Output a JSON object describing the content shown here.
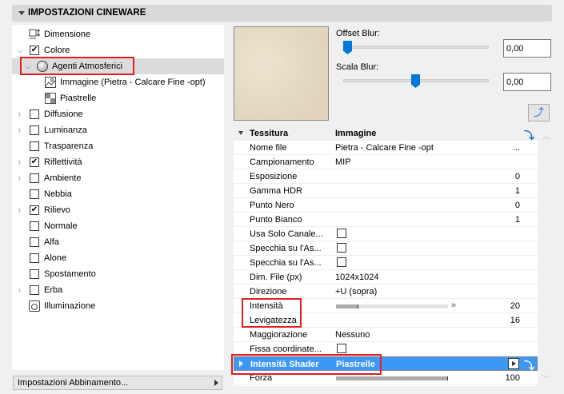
{
  "header": {
    "title": "IMPOSTAZIONI CINEWARE"
  },
  "tree": [
    {
      "label": "Dimensione",
      "icon": "dimension-icon",
      "level": 0,
      "arrow": "none"
    },
    {
      "label": "Colore",
      "check": true,
      "level": 0,
      "arrow": "open"
    },
    {
      "label": "Agenti Atmosferici",
      "icon": "sphere-icon",
      "level": 1,
      "arrow": "open",
      "selected": true
    },
    {
      "label": "Immagine (Pietra - Calcare Fine -opt)",
      "icon": "image-icon",
      "level": 2,
      "arrow": "none"
    },
    {
      "label": "Piastrelle",
      "icon": "tiles-icon",
      "level": 2,
      "arrow": "none"
    },
    {
      "label": "Diffusione",
      "check": false,
      "level": 0,
      "arrow": "closed"
    },
    {
      "label": "Luminanza",
      "check": false,
      "level": 0,
      "arrow": "closed"
    },
    {
      "label": "Trasparenza",
      "check": false,
      "level": 0,
      "arrow": "none"
    },
    {
      "label": "Riflettività",
      "check": true,
      "level": 0,
      "arrow": "closed"
    },
    {
      "label": "Ambiente",
      "check": false,
      "level": 0,
      "arrow": "closed"
    },
    {
      "label": "Nebbia",
      "check": false,
      "level": 0,
      "arrow": "none"
    },
    {
      "label": "Rilievo",
      "check": true,
      "level": 0,
      "arrow": "closed"
    },
    {
      "label": "Normale",
      "check": false,
      "level": 0,
      "arrow": "none"
    },
    {
      "label": "Alfa",
      "check": false,
      "level": 0,
      "arrow": "none"
    },
    {
      "label": "Alone",
      "check": false,
      "level": 0,
      "arrow": "none"
    },
    {
      "label": "Spostamento",
      "check": false,
      "level": 0,
      "arrow": "none"
    },
    {
      "label": "Erba",
      "check": false,
      "level": 0,
      "arrow": "closed"
    },
    {
      "label": "Illuminazione",
      "icon": "illumination-icon",
      "level": 0,
      "arrow": "none"
    }
  ],
  "match_button": "Impostazioni Abbinamento...",
  "blur": {
    "offset_label": "Offset Blur:",
    "offset_value": "0,00",
    "offset_slider": 0,
    "scale_label": "Scala Blur:",
    "scale_value": "0,00",
    "scale_slider": 0.5
  },
  "table": {
    "header": {
      "c1": "Tessitura",
      "c2": "Immagine"
    },
    "rows": [
      {
        "c1": "Nome file",
        "c2": "Pietra - Calcare Fine -opt",
        "c3": "..."
      },
      {
        "c1": "Campionamento",
        "c2": "MIP"
      },
      {
        "c1": "Esposizione",
        "c3": "0"
      },
      {
        "c1": "Gamma HDR",
        "c3": "1"
      },
      {
        "c1": "Punto Nero",
        "c3": "0"
      },
      {
        "c1": "Punto Bianco",
        "c3": "1"
      },
      {
        "c1": "Usa Solo Canale...",
        "checkbox": false
      },
      {
        "c1": "Specchia su l'As...",
        "checkbox": false
      },
      {
        "c1": "Specchia su l'As...",
        "checkbox": false
      },
      {
        "c1": "Dim. File (px)",
        "c2": "1024x1024"
      },
      {
        "c1": "Direzione",
        "c2": "+U (sopra)"
      },
      {
        "c1": "Intensità",
        "c3": "20",
        "bar": 0.2
      },
      {
        "c1": "Levigatezza",
        "c3": "16"
      },
      {
        "c1": "Maggiorazione",
        "c2": "Nessuno"
      },
      {
        "c1": "Fissa coordinate...",
        "checkbox": false
      },
      {
        "c1": "Intensità Shader",
        "c2": "Piastrelle",
        "highlight": true
      },
      {
        "c1": "Forza",
        "c3": "100",
        "bar": 1.0
      }
    ]
  },
  "colors": {
    "accent": "#0078d7",
    "highlight": "#3d97f5",
    "annotation": "#e02020"
  }
}
